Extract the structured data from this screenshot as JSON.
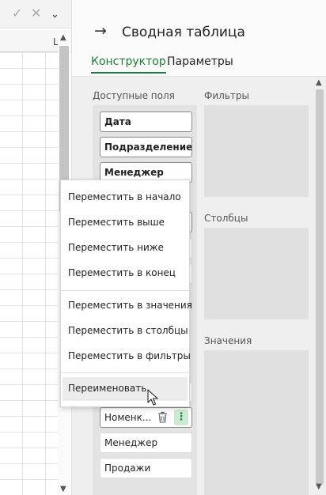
{
  "sheet": {
    "formula_bar": {
      "accept_icon": "✓",
      "cancel_icon": "✕",
      "expand_icon": "⌄"
    },
    "column_header_label": "L"
  },
  "panel": {
    "back_icon": "→",
    "title": "Сводная таблица",
    "tabs": [
      {
        "label": "Конструктор",
        "active": true
      },
      {
        "label": "Параметры",
        "active": false
      }
    ],
    "sections": {
      "available": "Доступные поля",
      "filters": "Фильтры",
      "columns": "Столбцы",
      "values": "Значения"
    },
    "fields_top": [
      {
        "label": "Дата"
      },
      {
        "label": "Подразделение"
      },
      {
        "label": "Менеджер"
      }
    ],
    "fields_bottom": [
      {
        "label": "Номенк..."
      },
      {
        "label": "Менеджер"
      },
      {
        "label": "Продажи"
      }
    ],
    "field_more_icon": "⋮",
    "field_trash_icon": "🗑"
  },
  "context_menu": {
    "groups": [
      [
        "Переместить в начало",
        "Переместить выше",
        "Переместить ниже",
        "Переместить в конец"
      ],
      [
        "Переместить в значения",
        "Переместить в столбцы",
        "Переместить в фильтры"
      ],
      [
        "Переименовать"
      ]
    ],
    "hovered_item": "Переименовать"
  },
  "colors": {
    "accent": "#1e7d3a",
    "accent_light": "#cdebd2"
  }
}
